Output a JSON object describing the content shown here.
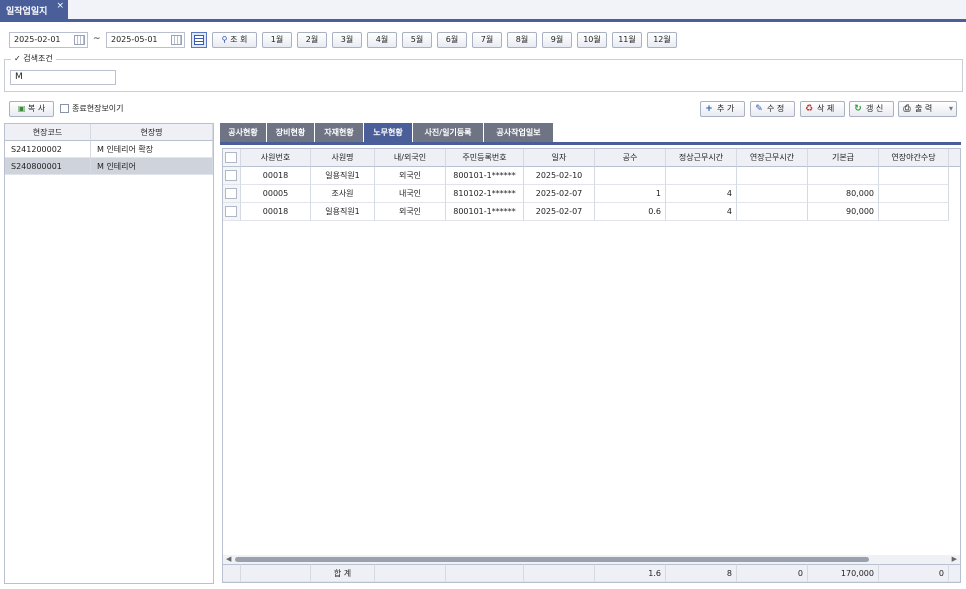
{
  "window": {
    "tab_title": "일작업일지",
    "tab_close": "×"
  },
  "filters": {
    "date_from": "2025-02-01",
    "date_to": "2025-05-01",
    "tilde": "~",
    "search_label": "조 회",
    "months": [
      "1월",
      "2월",
      "3월",
      "4월",
      "5월",
      "6월",
      "7월",
      "8월",
      "9월",
      "10월",
      "11월",
      "12월"
    ]
  },
  "search_condition": {
    "legend": "검색조건",
    "value": "M"
  },
  "left_panel": {
    "copy_label": "복 사",
    "show_closed_label": "종료현장보이기",
    "columns": [
      "현장코드",
      "현장명"
    ],
    "rows": [
      {
        "code": "S241200002",
        "name": "M 인테리어 확장"
      },
      {
        "code": "S240800001",
        "name": "M 인테리어"
      }
    ]
  },
  "sub_tabs": [
    "공사현황",
    "장비현황",
    "자재현황",
    "노무현황",
    "사진/일기등록",
    "공사작업일보"
  ],
  "active_sub_tab": "노무현황",
  "actions": {
    "add": "추 가",
    "edit": "수 정",
    "delete": "삭 제",
    "refresh": "갱 신",
    "print": "출 력"
  },
  "grid": {
    "columns": [
      "사원번호",
      "사원명",
      "내/외국인",
      "주민등록번호",
      "일자",
      "공수",
      "정상근무시간",
      "연장근무시간",
      "기본급",
      "연장야간수당"
    ],
    "rows": [
      [
        "00018",
        "일용직원1",
        "외국인",
        "800101-1******",
        "2025-02-10",
        "",
        "",
        "",
        "",
        ""
      ],
      [
        "00005",
        "조사원",
        "내국인",
        "810102-1******",
        "2025-02-07",
        "1",
        "4",
        "",
        "80,000",
        ""
      ],
      [
        "00018",
        "일용직원1",
        "외국인",
        "800101-1******",
        "2025-02-07",
        "0.6",
        "4",
        "",
        "90,000",
        ""
      ]
    ],
    "footer": {
      "label": "합 계",
      "gongsu": "1.6",
      "normal_hours": "8",
      "overtime_hours": "0",
      "base_pay": "170,000",
      "night_pay": "0"
    }
  },
  "colors": {
    "accent": "#4a5f99",
    "tab_inactive": "#6e7483"
  }
}
